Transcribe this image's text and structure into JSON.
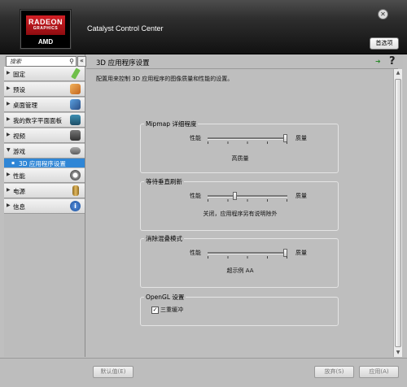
{
  "app": {
    "title": "Catalyst Control Center",
    "logo_line1": "RADEON",
    "logo_line2": "GRAPHICS",
    "logo_brand": "AMD",
    "preferences": "首选项",
    "close_glyph": "✕",
    "brand_color": "#d41f25"
  },
  "sidebar": {
    "search_placeholder": "搜索",
    "collapse_glyph": "«",
    "items": [
      {
        "label": "固定",
        "arrow": "▶",
        "icon": "pin-icon",
        "color": "#6fbf4a"
      },
      {
        "label": "预设",
        "arrow": "▶",
        "icon": "presets-icon",
        "color": "#e08a2c"
      },
      {
        "label": "桌面管理",
        "arrow": "▶",
        "icon": "desktop-management-icon",
        "color": "#3a6fb0"
      },
      {
        "label": "我的数字平面面板",
        "arrow": "▶",
        "icon": "flat-panel-icon",
        "color": "#2f6f8f"
      },
      {
        "label": "视频",
        "arrow": "▶",
        "icon": "video-icon",
        "color": "#5a5a5a"
      },
      {
        "label": "游戏",
        "arrow": "▼",
        "icon": "gamepad-icon",
        "color": "#7a7a7a"
      },
      {
        "label": "性能",
        "arrow": "▶",
        "icon": "gauge-icon",
        "color": "#8a8a8a"
      },
      {
        "label": "电源",
        "arrow": "▶",
        "icon": "battery-icon",
        "color": "#c79a3a"
      },
      {
        "label": "信息",
        "arrow": "▶",
        "icon": "info-icon",
        "color": "#2c67b5"
      }
    ],
    "subitem": {
      "label": "3D 应用程序设置",
      "selected": true
    }
  },
  "main": {
    "title": "3D 应用程序设置",
    "help": "?",
    "description": "配置用来控制 3D 应用程序的图像质量和性能的设置。",
    "groups": [
      {
        "title": "Mipmap 详细程度",
        "left_label": "性能",
        "right_label": "质量",
        "value_text": "高质量",
        "slider_level": 1.0
      },
      {
        "title": "等待垂直刷新",
        "left_label": "性能",
        "right_label": "质量",
        "value_text": "关闭，应用程序另有说明除外",
        "slider_level": 0.33
      },
      {
        "title": "消除混叠模式",
        "left_label": "性能",
        "right_label": "质量",
        "value_text": "超示例 AA",
        "slider_level": 1.0
      }
    ],
    "opengl": {
      "title": "OpenGL 设置",
      "checkbox_label": "三重缓冲",
      "checked": true
    }
  },
  "bottom": {
    "defaults": "默认值(E)",
    "discard": "放弃(S)",
    "apply": "应用(A)"
  }
}
